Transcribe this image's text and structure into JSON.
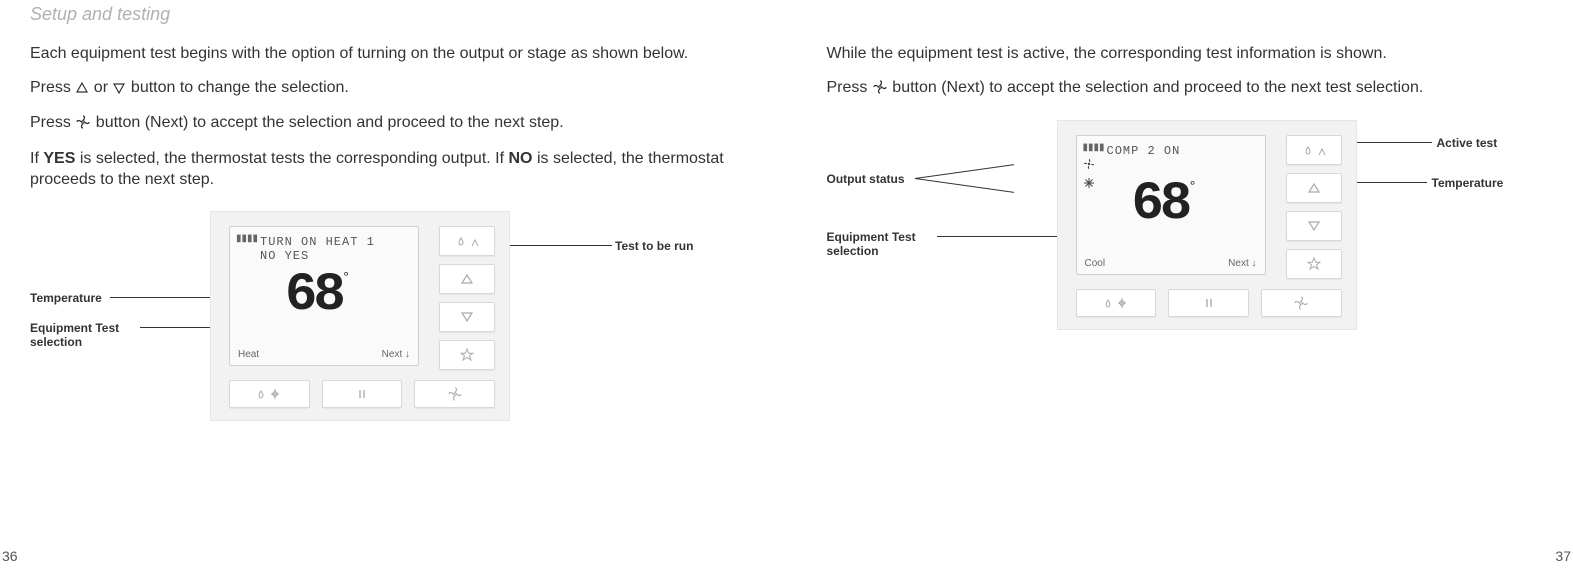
{
  "header": {
    "section_title": "Setup and testing"
  },
  "left_col": {
    "p1": "Each equipment test begins with the option of turning on the output or stage as shown below.",
    "p2_pre": "Press ",
    "p2_mid": " or ",
    "p2_post": " button to change the selection.",
    "p3_pre": "Press ",
    "p3_post": " button (Next) to accept the selection and proceed to the next step.",
    "p4_pre": "If ",
    "p4_yes": "YES",
    "p4_mid": " is selected, the thermostat tests the corresponding output. If ",
    "p4_no": "NO",
    "p4_post": " is selected, the thermostat proceeds to the next step.",
    "callouts": {
      "test_to_run": "Test to be run",
      "temperature": "Temperature",
      "equip_test_sel": "Equipment Test selection"
    },
    "device": {
      "msg_line1": "TURN ON HEAT 1",
      "msg_line2": "NO YES",
      "temp": "68",
      "mode": "Heat",
      "next": "Next ↓"
    }
  },
  "right_col": {
    "p1": "While the equipment test is active, the corresponding test information is shown.",
    "p2_pre": "Press ",
    "p2_post": " button (Next) to accept the selection and proceed to the next test selection.",
    "callouts": {
      "output_status": "Output status",
      "equip_test_sel": "Equipment Test selection",
      "active_test": "Active test",
      "temperature": "Temperature"
    },
    "device": {
      "msg_line1": "COMP 2 ON",
      "temp": "68",
      "mode": "Cool",
      "next": "Next ↓"
    }
  },
  "page_numbers": {
    "left": "36",
    "right": "37"
  }
}
